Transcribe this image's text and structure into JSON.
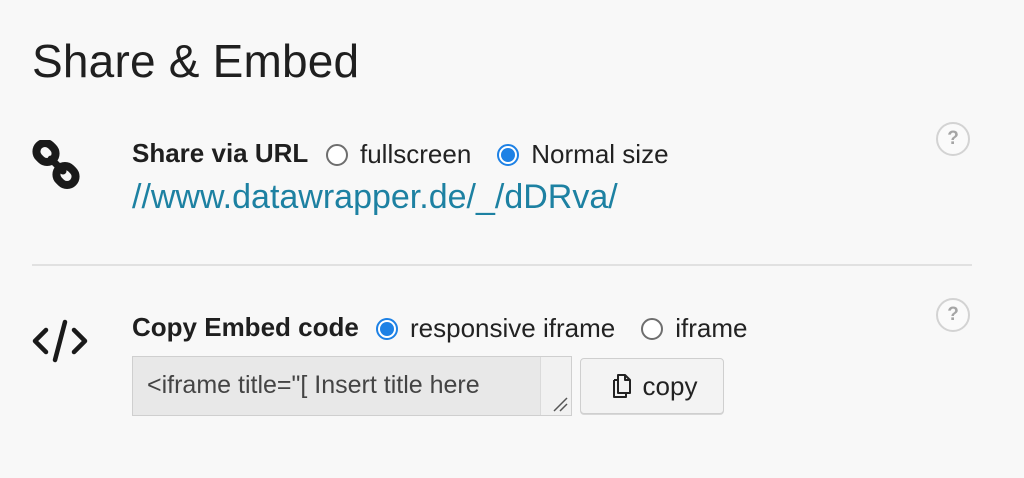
{
  "page": {
    "title": "Share & Embed"
  },
  "share": {
    "label": "Share via URL",
    "options": [
      {
        "label": "fullscreen",
        "checked": false
      },
      {
        "label": "Normal size",
        "checked": true
      }
    ],
    "url": "//www.datawrapper.de/_/dDRva/",
    "help": "?"
  },
  "embed": {
    "label": "Copy Embed code",
    "options": [
      {
        "label": "responsive iframe",
        "checked": true
      },
      {
        "label": "iframe",
        "checked": false
      }
    ],
    "code": "<iframe title=\"[ Insert title here",
    "copy_label": "copy",
    "help": "?"
  },
  "colors": {
    "accent": "#1d81e5",
    "link": "#1d81a2"
  },
  "icons": {
    "share": "link-icon",
    "embed": "code-icon",
    "copy": "copy-icon"
  }
}
